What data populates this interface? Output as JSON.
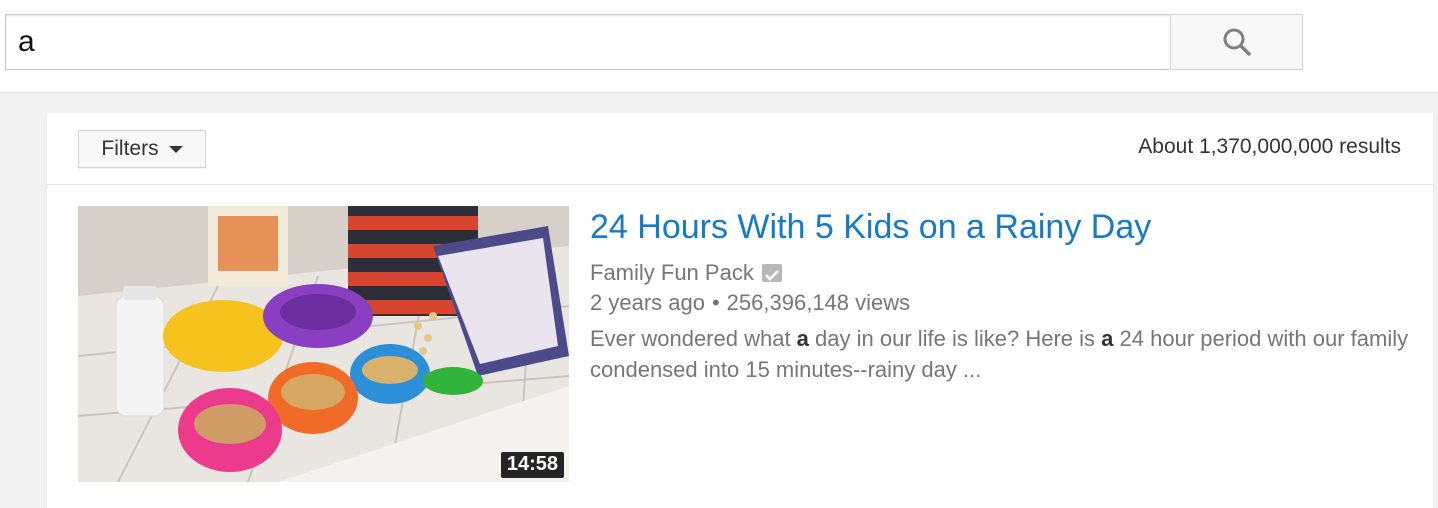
{
  "search": {
    "query": "a",
    "button_icon": "search-icon"
  },
  "filters": {
    "label": "Filters",
    "caret_icon": "caret-down-icon"
  },
  "results_count": "About 1,370,000,000 results",
  "video": {
    "title": "24 Hours With 5 Kids on a Rainy Day",
    "channel": "Family Fun Pack",
    "verified_icon": "verified-check-icon",
    "age": "2 years ago",
    "separator": "•",
    "views": "256,396,148 views",
    "description_parts": [
      "Ever wondered what ",
      "a",
      " day in our life is like? Here is ",
      "a",
      " 24 hour period with our family condensed into 15 minutes--rainy day ..."
    ],
    "duration": "14:58"
  },
  "colors": {
    "link_blue": "#167ac6",
    "meta_gray": "#767676",
    "page_bg": "#f1f1f1"
  }
}
